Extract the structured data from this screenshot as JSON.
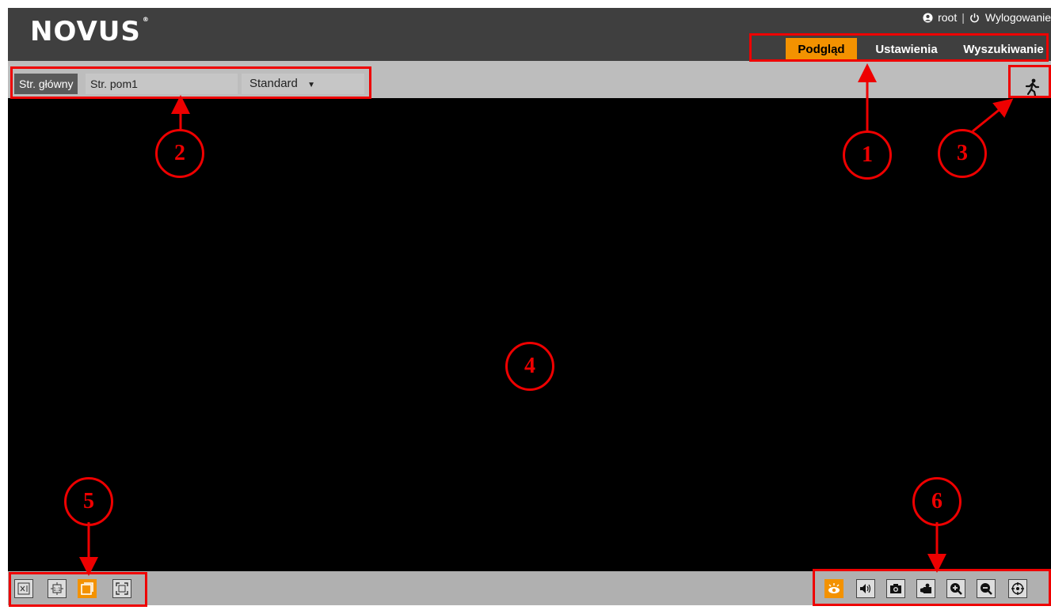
{
  "logo": {
    "text": "NOVUS",
    "mark": "®"
  },
  "user": {
    "name": "root",
    "separator": "|",
    "logout": "Wylogowanie"
  },
  "tabs": [
    {
      "label": "Podgląd",
      "active": true
    },
    {
      "label": "Ustawienia",
      "active": false
    },
    {
      "label": "Wyszukiwanie",
      "active": false
    }
  ],
  "stream": {
    "main_label": "Str. główny",
    "sub_label": "Str. pom1",
    "quality_label": "Standard"
  },
  "annotations": [
    "1",
    "2",
    "3",
    "4",
    "5",
    "6"
  ],
  "colors": {
    "accent": "#f39200",
    "annotation": "#e00000",
    "header": "#3f3f3f",
    "toolbar": "#bdbdbd"
  },
  "icons": {
    "bottom_left": [
      "original-size-icon",
      "fit-1-1-icon",
      "fit-window-icon",
      "fullscreen-icon"
    ],
    "bottom_right": [
      "live-view-icon",
      "audio-icon",
      "snapshot-icon",
      "record-icon",
      "zoom-in-icon",
      "zoom-out-icon",
      "ptz-target-icon"
    ],
    "motion": "motion-alarm-icon"
  }
}
